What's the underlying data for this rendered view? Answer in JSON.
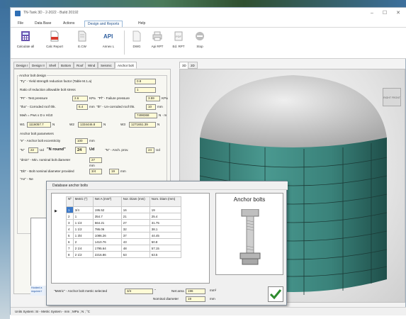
{
  "window": {
    "title": "TN-Tank 3D - 2-2022 - Build 20192",
    "controls": [
      "–",
      "☐",
      "✕"
    ]
  },
  "menu": [
    "File",
    "Data Base",
    "Actions",
    "Design and Reports",
    "Help"
  ],
  "menu_active_index": 3,
  "ribbon": {
    "calculate_all": "Calculate all",
    "calc_report": "Calc Report",
    "ecw": "E.CW",
    "annex_l": "Annex L",
    "dwg": "DWG",
    "api_rpt": "Api RPT",
    "ed_rpt": "Ed. RPT",
    "stop": "Stop"
  },
  "tabs": [
    "Design I",
    "Design II",
    "Shell",
    "Bottom",
    "Roof",
    "Wind",
    "Seismic",
    "Anchor bolt"
  ],
  "tabs_active_index": 7,
  "view_tabs": [
    "3D",
    "2D"
  ],
  "view_tabs_active_index": 0,
  "anchor": {
    "design_heading": "Anchor bolt design",
    "fy_label": "\"Fy\" - Yield strength reduction factor (Table M.1.a)",
    "fy_value": "0.8",
    "ratio_label": "Ratio of reduction allowable bolt stress",
    "ratio_value": "1",
    "pt_label": "\"Pt\" - Test pressure",
    "pt_value": "2.6",
    "pt_unit": "KPa",
    "pf_label": "\"Pf\" - Failure pressure",
    "pf_value": "3.59",
    "pf_unit": "KPa",
    "tha_label": "\"tha\" - Corroded roof thk.",
    "tha_value": "6.4",
    "tha_unit": "mm",
    "th_label": "\"th\" - Un-corroded roof thk.",
    "th_value": "10",
    "th_unit": "mm",
    "mwh_label": "Mwh = Pws x D x H/10",
    "mwh_value": "7498368",
    "mwh_unit": "N · m",
    "w1_label": "W1",
    "w1_value": "1116057.7",
    "w1_unit": "N",
    "w2_label": "W2",
    "w2_value": "1334446.8",
    "w2_unit": "N",
    "w3_label": "W3",
    "w3_value": "1271651.39",
    "w3_unit": "N",
    "params_heading": "Anchor bolt parameters",
    "e_label": "\"e\" - Anchor bolt eccentricity",
    "e_value": "100",
    "e_unit": "mm",
    "n_label": "\"N\"",
    "n_value": "22",
    "n_unit": "Ud",
    "nround_label": "\"N round\"",
    "nround_value": "24",
    "nround_unit": "Ud",
    "nanch_label": "\"N\" - Anch. prov.",
    "nanch_value": "24",
    "nanch_unit": "Ud",
    "dmin_label": "\"dmin\" - Min. nominal bolt diameter",
    "dmin_value": "27",
    "dmin_unit": "mm",
    "db_label": "\"Db\" - Bolt nominal diameter provided",
    "db_value": "3/4",
    "db_value2": "19",
    "db_unit": "mm",
    "an_label": "\"An\" - Ne"
  },
  "dialog": {
    "title": "Database anchor bolts",
    "columns": [
      "Nº",
      "Metric (\")",
      "Net A (mm²)",
      "Nor. Diam (mm)",
      "Nom. Diam (mm)"
    ],
    "rows": [
      [
        "1",
        "3/4",
        "195.52",
        "16",
        "19"
      ],
      [
        "2",
        "1",
        "354.7",
        "21",
        "25.4"
      ],
      [
        "3",
        "1 1/4",
        "564.21",
        "27",
        "31.75"
      ],
      [
        "4",
        "1 1/2",
        "786.06",
        "32",
        "38.1"
      ],
      [
        "5",
        "1 3/4",
        "1086.26",
        "37",
        "44.45"
      ],
      [
        "6",
        "2",
        "1410.76",
        "43",
        "50.8"
      ],
      [
        "7",
        "2 1/4",
        "1795.64",
        "48",
        "57.15"
      ],
      [
        "8",
        "2 1/2",
        "2216.86",
        "53",
        "63.5"
      ]
    ],
    "selected_row": 0,
    "picture_title": "Anchor bolts",
    "metric_label": "\"Metric\" - Anchor bolt metric selected",
    "metric_value": "3/4",
    "metric_unit": "\"",
    "netarea_label": "Net area",
    "netarea_value": "196",
    "netarea_unit": "mm²",
    "nomdiam_label": "Nominal diameter",
    "nomdiam_value": "19",
    "nomdiam_unit": "mm",
    "ok_icon": "checkmark-icon"
  },
  "status_note": "Hooked a required f",
  "statusbar": "Units System: SI - Metric System - mm ; MPa ; N ; °C",
  "viewcube_label": "RIGHT FRONT",
  "colors": {
    "accent": "#2f6fb5",
    "tank": "#3f8a82",
    "roof": "#d2d2d2",
    "field": "#fffbd6",
    "ok": "#2e8b2e"
  }
}
